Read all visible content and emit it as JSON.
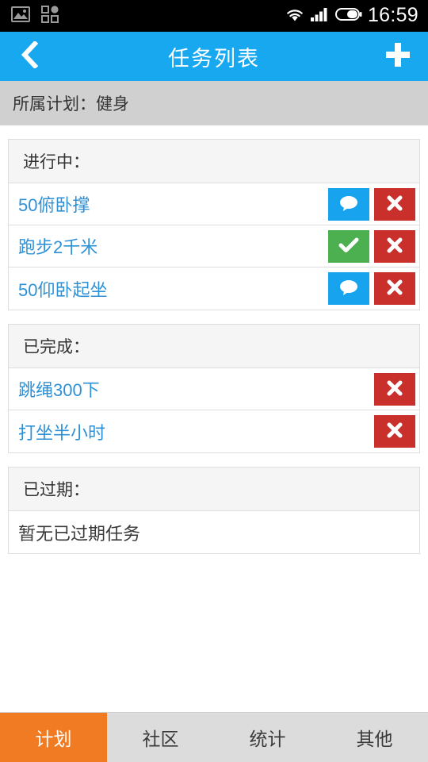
{
  "status_bar": {
    "icons_left": [
      "image-icon",
      "apps-grid-icon"
    ],
    "icons_right": [
      "wifi-icon",
      "signal-icon",
      "battery-icon"
    ],
    "time": "16:59"
  },
  "header": {
    "title": "任务列表",
    "back_icon": "chevron-left-icon",
    "add_icon": "plus-icon"
  },
  "plan_bar": {
    "text": "所属计划：健身"
  },
  "sections": [
    {
      "heading": "进行中：",
      "rows": [
        {
          "label": "50俯卧撑",
          "actions": [
            "comment",
            "remove"
          ]
        },
        {
          "label": "跑步2千米",
          "actions": [
            "done",
            "remove"
          ]
        },
        {
          "label": "50仰卧起坐",
          "actions": [
            "comment",
            "remove"
          ]
        }
      ]
    },
    {
      "heading": "已完成：",
      "rows": [
        {
          "label": "跳绳300下",
          "actions": [
            "remove"
          ]
        },
        {
          "label": "打坐半小时",
          "actions": [
            "remove"
          ]
        }
      ]
    },
    {
      "heading": "已过期：",
      "rows": [
        {
          "label": "暂无已过期任务",
          "actions": []
        }
      ]
    }
  ],
  "tabs": [
    {
      "label": "计划",
      "active": true
    },
    {
      "label": "社区",
      "active": false
    },
    {
      "label": "统计",
      "active": false
    },
    {
      "label": "其他",
      "active": false
    }
  ],
  "colors": {
    "header_blue": "#17a8f0",
    "tab_active_orange": "#f07b22",
    "link_blue": "#2e91d6",
    "danger_red": "#c9302c",
    "success_green": "#4caf50",
    "comment_blue": "#18a3ef",
    "plan_bar_gray": "#d0d0d0",
    "section_head_gray": "#f5f5f5"
  }
}
